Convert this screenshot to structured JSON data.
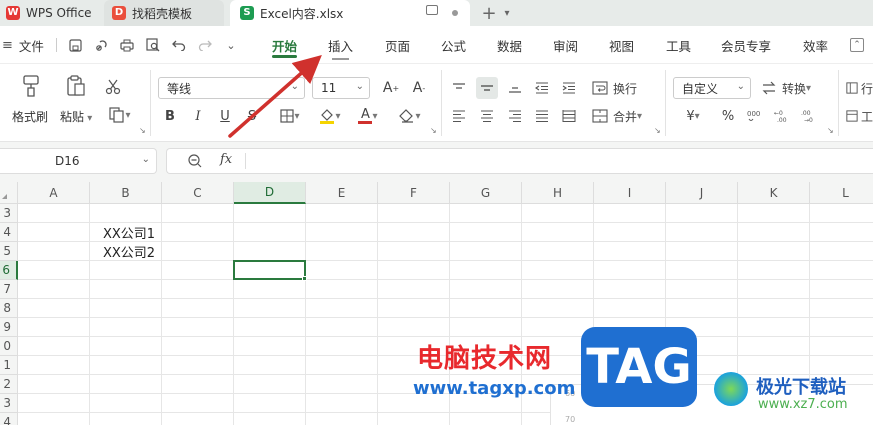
{
  "tabs": [
    {
      "label": "WPS Office",
      "icon": "wps-logo-icon"
    },
    {
      "label": "找稻壳模板",
      "icon": "docer-logo-icon"
    },
    {
      "label": "Excel内容.xlsx",
      "icon": "sheet-icon",
      "icon_letter": "S"
    }
  ],
  "menu": {
    "file_label": "文件",
    "items": [
      "开始",
      "插入",
      "页面",
      "公式",
      "数据",
      "审阅",
      "视图",
      "工具",
      "会员专享",
      "效率"
    ],
    "active": "开始"
  },
  "ribbon": {
    "format_painter": "格式刷",
    "paste": "粘贴",
    "font_name": "等线",
    "font_size": "11",
    "wrap": "换行",
    "merge": "合并",
    "number_format": "自定义",
    "convert": "转换",
    "currency_symbol": "¥",
    "percent_symbol": "%",
    "bold": "B",
    "italic": "I",
    "underline": "U",
    "strike": "S",
    "font_color_letter": "A",
    "row_col_partial": "行",
    "sheet_partial": "工"
  },
  "formula_bar": {
    "name_box": "D16",
    "fx": "fx"
  },
  "grid": {
    "columns": [
      "A",
      "B",
      "C",
      "D",
      "E",
      "F",
      "G",
      "H",
      "I",
      "J",
      "K",
      "L"
    ],
    "selected_column": "D",
    "rows": [
      "3",
      "4",
      "5",
      "6",
      "7",
      "8",
      "9",
      "0",
      "1",
      "2",
      "3",
      "4"
    ],
    "selected_row": "6",
    "cells": [
      {
        "row": "4",
        "col": "B",
        "value": "XX公司1"
      },
      {
        "row": "5",
        "col": "B",
        "value": "XX公司2"
      }
    ],
    "axis_hint_1": "60",
    "axis_hint_2": "70"
  },
  "watermarks": {
    "cn_site": "电脑技术网",
    "url": "www.tagxp.com",
    "tag_logo": "TAG",
    "jiguang": "极光下载站",
    "jiguang_url": "www.xz7.com"
  },
  "colors": {
    "accent": "#2a7a3e",
    "arrow": "#d0312d",
    "tag_blue": "#1f6fd1"
  }
}
